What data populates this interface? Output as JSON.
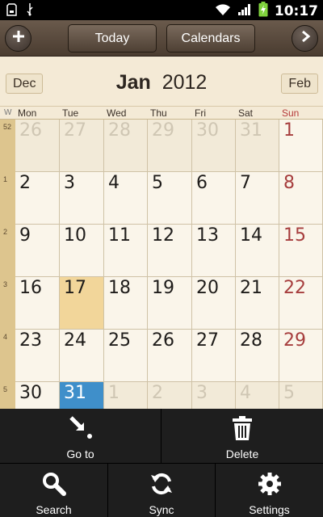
{
  "status_bar": {
    "time": "10:17",
    "icons": [
      "sd-card-icon",
      "usb-icon",
      "wifi-icon",
      "signal-icon",
      "battery-charging-icon"
    ]
  },
  "toolbar": {
    "add_icon": "plus-icon",
    "today_label": "Today",
    "calendars_label": "Calendars",
    "next_icon": "chevron-right-icon"
  },
  "month": {
    "prev": "Dec",
    "name": "Jan",
    "year": "2012",
    "next": "Feb"
  },
  "day_headers": {
    "week": "W",
    "days": [
      "Mon",
      "Tue",
      "Wed",
      "Thu",
      "Fri",
      "Sat",
      "Sun"
    ]
  },
  "weeks": [
    {
      "num": "52",
      "days": [
        "26",
        "27",
        "28",
        "29",
        "30",
        "31",
        "1"
      ]
    },
    {
      "num": "1",
      "days": [
        "2",
        "3",
        "4",
        "5",
        "6",
        "7",
        "8"
      ]
    },
    {
      "num": "2",
      "days": [
        "9",
        "10",
        "11",
        "12",
        "13",
        "14",
        "15"
      ]
    },
    {
      "num": "3",
      "days": [
        "16",
        "17",
        "18",
        "19",
        "20",
        "21",
        "22"
      ]
    },
    {
      "num": "4",
      "days": [
        "23",
        "24",
        "25",
        "26",
        "27",
        "28",
        "29"
      ]
    },
    {
      "num": "5",
      "days": [
        "30",
        "31",
        "1",
        "2",
        "3",
        "4",
        "5"
      ]
    }
  ],
  "menu": {
    "goto": "Go to",
    "delete": "Delete",
    "search": "Search",
    "sync": "Sync",
    "settings": "Settings"
  },
  "colors": {
    "today": "#f2d69a",
    "selected": "#3f8fca",
    "sunday": "#a63d3d"
  }
}
